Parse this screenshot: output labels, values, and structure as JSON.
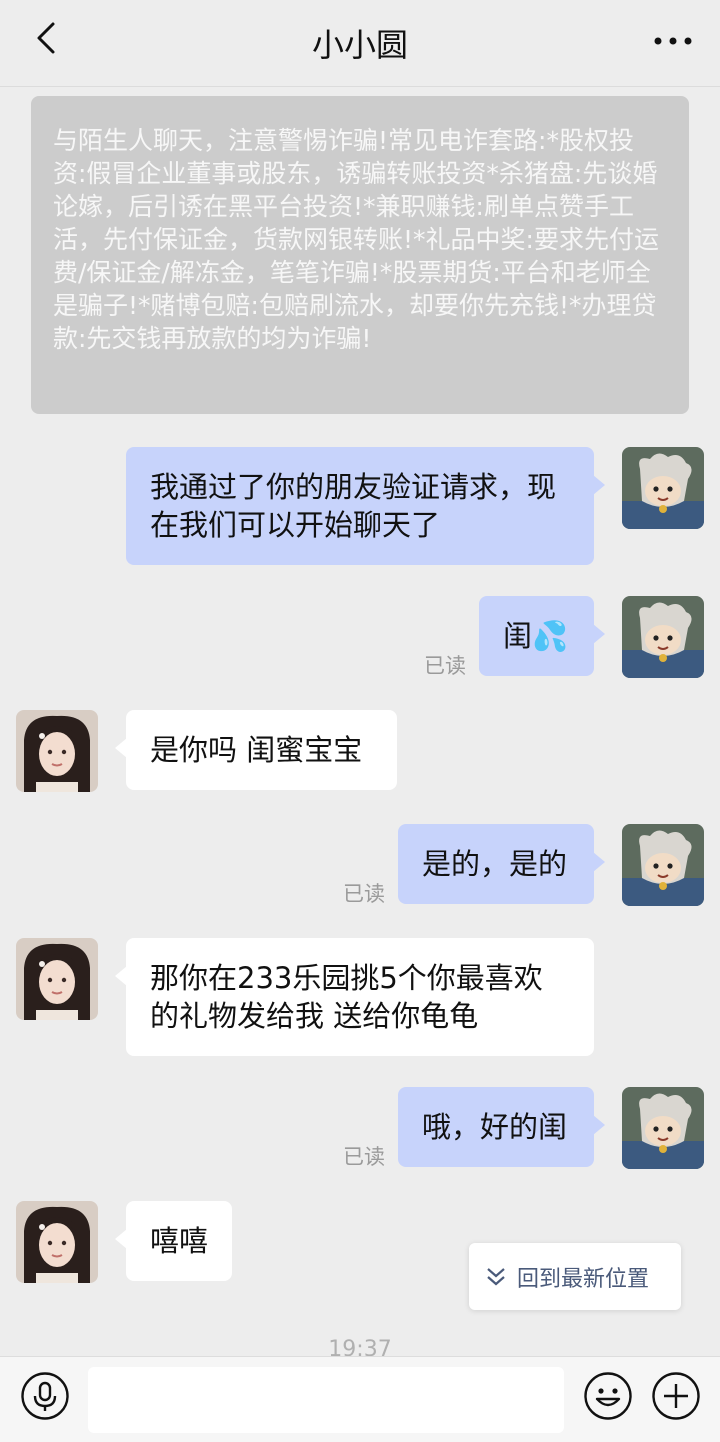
{
  "header": {
    "title": "小小圆",
    "back_icon": "chevron-left-icon",
    "more_icon": "more-dots-icon"
  },
  "notice": {
    "text": "与陌生人聊天，注意警惕诈骗!常见电诈套路:*股权投资:假冒企业董事或股东，诱骗转账投资*杀猪盘:先谈婚论嫁，后引诱在黑平台投资!*兼职赚钱:刷单点赞手工活，先付保证金，货款网银转账!*礼品中奖:要求先付运费/保证金/解冻金，笔笔诈骗!*股票期货:平台和老师全是骗子!*赌博包赔:包赔刷流水，却要你先充钱!*办理贷款:先交钱再放款的均为诈骗!"
  },
  "messages": [
    {
      "from": "me",
      "text": "我通过了你的朋友验证请求，现在我们可以开始聊天了",
      "status": ""
    },
    {
      "from": "me",
      "text": "闺💦",
      "status": "已读"
    },
    {
      "from": "her",
      "text": "是你吗 闺蜜宝宝",
      "status": ""
    },
    {
      "from": "me",
      "text": "是的，是的",
      "status": "已读"
    },
    {
      "from": "her",
      "text": "那你在233乐园挑5个你最喜欢的礼物发给我 送给你龟龟",
      "status": ""
    },
    {
      "from": "me",
      "text": "哦，好的闺",
      "status": "已读"
    },
    {
      "from": "her",
      "text": "嘻嘻",
      "status": ""
    }
  ],
  "jump_to_latest": {
    "label": "回到最新位置",
    "icon": "double-chevron-down-icon"
  },
  "timestamp": "19:37",
  "input_bar": {
    "voice_icon": "microphone-icon",
    "placeholder": "",
    "emoji_icon": "emoji-icon",
    "plus_icon": "plus-icon"
  },
  "colors": {
    "background": "#ededed",
    "my_bubble": "#c7d3fb",
    "her_bubble": "#ffffff",
    "notice_bg": "#cccccc",
    "read_status": "#9a9a9a"
  }
}
